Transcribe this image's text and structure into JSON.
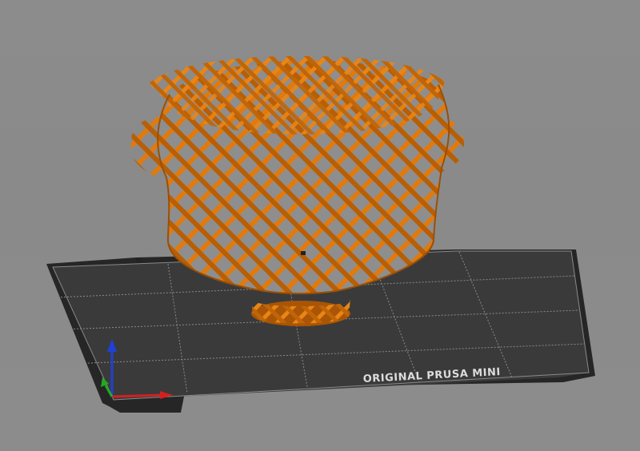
{
  "bed": {
    "label": "ORIGINAL PRUSA MINI",
    "colors": {
      "bed": "#3a3a3a",
      "bed_rim": "#262626",
      "grid": "#8a8a8a",
      "label": "#dcdcdc"
    }
  },
  "model": {
    "color": "#e07a0e",
    "shade": "#b85e05",
    "highlight": "#f29222"
  },
  "axes": {
    "x_color": "#d42020",
    "y_color": "#22aa22",
    "z_color": "#2040d8"
  },
  "background": "#8b8b8b"
}
